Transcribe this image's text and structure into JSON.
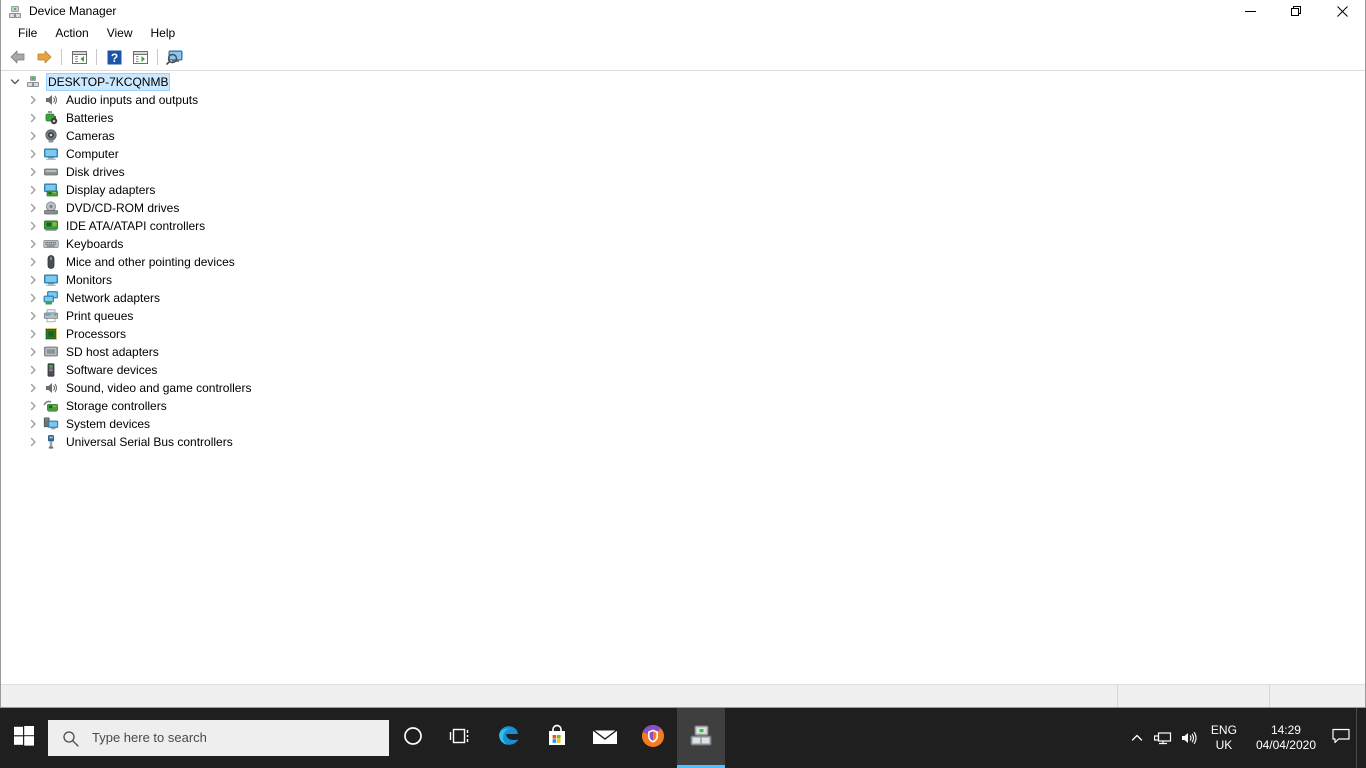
{
  "window": {
    "title": "Device Manager",
    "icon": "device-manager-icon",
    "controls": [
      {
        "name": "minimize-button",
        "glyph": "minimize"
      },
      {
        "name": "restore-button",
        "glyph": "restore"
      },
      {
        "name": "close-button",
        "glyph": "close"
      }
    ]
  },
  "menubar": {
    "items": [
      {
        "label": "File"
      },
      {
        "label": "Action"
      },
      {
        "label": "View"
      },
      {
        "label": "Help"
      }
    ]
  },
  "toolbar": {
    "buttons": [
      {
        "name": "back-button",
        "icon": "back-arrow-icon"
      },
      {
        "name": "forward-button",
        "icon": "forward-arrow-icon"
      },
      {
        "name": "show-hide-console-tree-button",
        "icon": "console-tree-icon"
      },
      {
        "name": "help-button",
        "icon": "help-question-icon"
      },
      {
        "name": "properties-button",
        "icon": "properties-icon"
      },
      {
        "name": "scan-for-hardware-changes-button",
        "icon": "scan-hardware-icon"
      }
    ]
  },
  "tree": {
    "root": {
      "label": "DESKTOP-7KCQNMB",
      "icon": "computer-node-icon",
      "expanded": true,
      "selected": true
    },
    "items": [
      {
        "label": "Audio inputs and outputs",
        "icon": "audio-icon"
      },
      {
        "label": "Batteries",
        "icon": "battery-icon"
      },
      {
        "label": "Cameras",
        "icon": "camera-icon"
      },
      {
        "label": "Computer",
        "icon": "computer-icon"
      },
      {
        "label": "Disk drives",
        "icon": "disk-drive-icon"
      },
      {
        "label": "Display adapters",
        "icon": "display-adapter-icon"
      },
      {
        "label": "DVD/CD-ROM drives",
        "icon": "dvd-drive-icon"
      },
      {
        "label": "IDE ATA/ATAPI controllers",
        "icon": "ide-controller-icon"
      },
      {
        "label": "Keyboards",
        "icon": "keyboard-icon"
      },
      {
        "label": "Mice and other pointing devices",
        "icon": "mouse-icon"
      },
      {
        "label": "Monitors",
        "icon": "monitor-icon"
      },
      {
        "label": "Network adapters",
        "icon": "network-adapter-icon"
      },
      {
        "label": "Print queues",
        "icon": "printer-icon"
      },
      {
        "label": "Processors",
        "icon": "processor-icon"
      },
      {
        "label": "SD host adapters",
        "icon": "sd-host-icon"
      },
      {
        "label": "Software devices",
        "icon": "software-device-icon"
      },
      {
        "label": "Sound, video and game controllers",
        "icon": "sound-controller-icon"
      },
      {
        "label": "Storage controllers",
        "icon": "storage-controller-icon"
      },
      {
        "label": "System devices",
        "icon": "system-device-icon"
      },
      {
        "label": "Universal Serial Bus controllers",
        "icon": "usb-controller-icon"
      }
    ]
  },
  "statusbar": {
    "text": ""
  },
  "taskbar": {
    "start": {
      "name": "start-button",
      "icon": "windows-logo-icon"
    },
    "search": {
      "placeholder": "Type here to search",
      "icon": "search-icon"
    },
    "tasks": [
      {
        "name": "cortana-button",
        "icon": "cortana-circle-icon",
        "active": false
      },
      {
        "name": "task-view-button",
        "icon": "task-view-icon",
        "active": false
      },
      {
        "name": "edge-button",
        "icon": "edge-icon",
        "active": false
      },
      {
        "name": "microsoft-store-button",
        "icon": "store-icon",
        "active": false
      },
      {
        "name": "mail-button",
        "icon": "mail-icon",
        "active": false
      },
      {
        "name": "secure-browser-button",
        "icon": "secure-browser-icon",
        "active": false
      },
      {
        "name": "device-manager-taskbar-button",
        "icon": "device-manager-icon",
        "active": true
      }
    ],
    "tray": {
      "chevron": "show-hidden-icons-chevron",
      "icons": [
        {
          "name": "network-tray-icon",
          "icon": "network-icon"
        },
        {
          "name": "volume-tray-icon",
          "icon": "speaker-icon"
        }
      ],
      "language": {
        "line1": "ENG",
        "line2": "UK"
      },
      "clock": {
        "time": "14:29",
        "date": "04/04/2020"
      },
      "action_center": {
        "name": "action-center-button",
        "icon": "notification-icon"
      }
    }
  },
  "colors": {
    "selection": "#cce8ff",
    "taskbar": "#1f1f1f",
    "accent": "#4cc2ff",
    "window_bg": "#ffffff",
    "statusbar_bg": "#f0f0f0"
  }
}
